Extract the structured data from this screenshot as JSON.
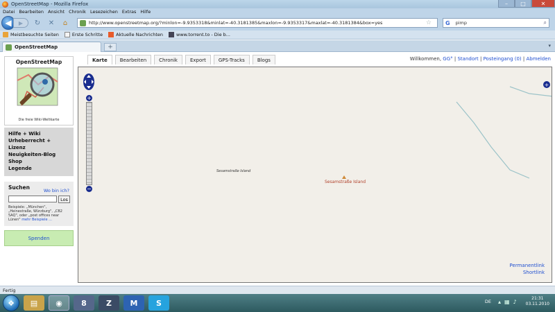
{
  "window": {
    "title": "OpenStreetMap - Mozilla Firefox"
  },
  "menubar": [
    "Datei",
    "Bearbeiten",
    "Ansicht",
    "Chronik",
    "Lesezeichen",
    "Extras",
    "Hilfe"
  ],
  "navbar": {
    "url": "http://www.openstreetmap.org/?minlon=-9.9353318&minlat=-40.3181385&maxlon=-9.9353317&maxlat=-40.3181384&box=yes",
    "search_value": "pimp"
  },
  "bookmarks": [
    "Meistbesuchte Seiten",
    "Erste Schritte",
    "Aktuelle Nachrichten",
    "www.torrent.to - Die b..."
  ],
  "browser_tab": {
    "label": "OpenStreetMap"
  },
  "osm": {
    "logo_title": "OpenStreetMap",
    "logo_tagline": "Die freie Wiki-Weltkarte",
    "links": [
      "Hilfe + Wiki",
      "Urheberrecht + Lizenz",
      "Neuigkeiten-Blog",
      "Shop",
      "Legende"
    ],
    "search": {
      "title": "Suchen",
      "where_link": "Wo bin ich?",
      "button": "Los",
      "hint": "Beispiele: „München\", „Heinestraße, Würzburg\", „CB2 5AQ\", oder „post offices near Lünen\"",
      "more": "mehr Beispiele ..."
    },
    "donate": "Spenden",
    "tabs": [
      "Karte",
      "Bearbeiten",
      "Chronik",
      "Export",
      "GPS-Tracks",
      "Blogs"
    ],
    "user": {
      "welcome": "Willkommen,",
      "name": "GG°",
      "sep1": "|",
      "location": "Standort",
      "sep2": "|",
      "inbox": "Posteingang (0)",
      "sep3": "|",
      "logout": "Abmelden"
    },
    "map": {
      "label_small": "Sesamstraße Island",
      "label_peak": "Sesamstraße Island",
      "permalink": "Permanentlink",
      "shortlink": "Shortlink"
    }
  },
  "status": "Fertig",
  "taskbar": {
    "lang": "DE",
    "time": "21:31",
    "date": "03.11.2010"
  }
}
